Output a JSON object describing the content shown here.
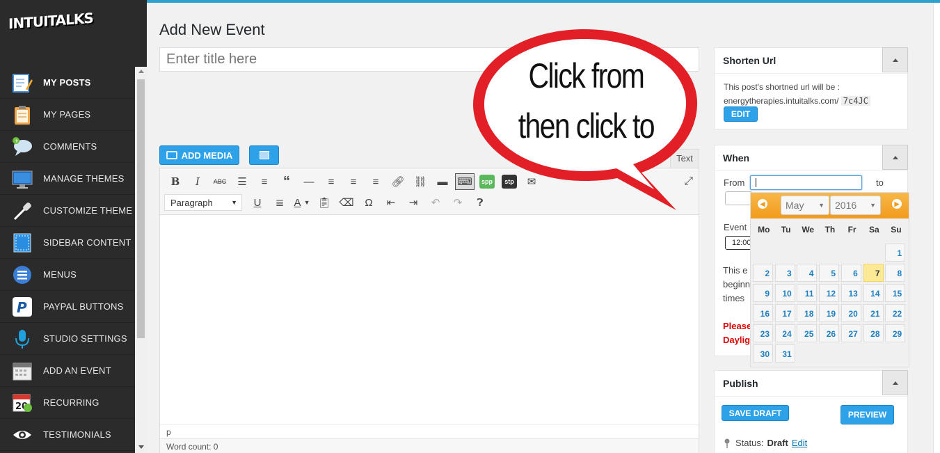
{
  "colors": {
    "accent": "#2ea2e8",
    "sidebar_bg": "#2b2b2b",
    "datepicker_header": "#f29a1c",
    "today_highlight": "#fbe996",
    "warning_text": "#dd0000",
    "callout_red": "#e21f26"
  },
  "logo": {
    "text": "INTUITALKS"
  },
  "sidebar": {
    "items": [
      {
        "label": "MY POSTS",
        "icon": "pencil-note-icon"
      },
      {
        "label": "MY PAGES",
        "icon": "clipboard-icon"
      },
      {
        "label": "COMMENTS",
        "icon": "speech-bubble-icon"
      },
      {
        "label": "MANAGE THEMES",
        "icon": "monitor-icon"
      },
      {
        "label": "CUSTOMIZE THEME",
        "icon": "eyedropper-icon"
      },
      {
        "label": "SIDEBAR CONTENT",
        "icon": "sidebar-layout-icon"
      },
      {
        "label": "MENUS",
        "icon": "hamburger-circle-icon"
      },
      {
        "label": "PAYPAL BUTTONS",
        "icon": "paypal-icon"
      },
      {
        "label": "STUDIO SETTINGS",
        "icon": "microphone-icon"
      },
      {
        "label": "ADD AN EVENT",
        "icon": "calendar-icon"
      },
      {
        "label": "RECURRING",
        "icon": "recurring-calendar-icon"
      },
      {
        "label": "TESTIMONIALS",
        "icon": "eye-icon"
      }
    ]
  },
  "main": {
    "page_title": "Add New Event",
    "title_placeholder": "Enter title here",
    "add_media_label": "ADD MEDIA",
    "text_tab_label": "Text",
    "paragraph_select": "Paragraph",
    "status_path": "p",
    "word_count": "Word count: 0",
    "toolbar_spp": "spp",
    "toolbar_stp": "stp"
  },
  "shorten": {
    "title": "Shorten Url",
    "line1": "This post's shortned url will be :",
    "domain": "energytherapies.intuitalks.com/",
    "code": "7c4JC",
    "edit_label": "EDIT"
  },
  "when": {
    "title": "When",
    "from_label": "From",
    "to_label": "to",
    "event_label": "Event",
    "time_value": "12:00",
    "desc_lines": [
      "This e",
      "beginn",
      "times"
    ],
    "warn_lines": [
      "Please",
      "Daylig"
    ]
  },
  "datepicker": {
    "month": "May",
    "year": "2016",
    "dows": [
      "Mo",
      "Tu",
      "We",
      "Th",
      "Fr",
      "Sa",
      "Su"
    ],
    "first_weekday_index": 6,
    "days_in_month": 31,
    "today": 7
  },
  "publish": {
    "title": "Publish",
    "save_draft_label": "SAVE DRAFT",
    "preview_label": "PREVIEW",
    "status_label": "Status:",
    "status_value": "Draft",
    "status_edit": "Edit"
  },
  "callout": {
    "line1": "Click from",
    "line2": "then click to"
  }
}
